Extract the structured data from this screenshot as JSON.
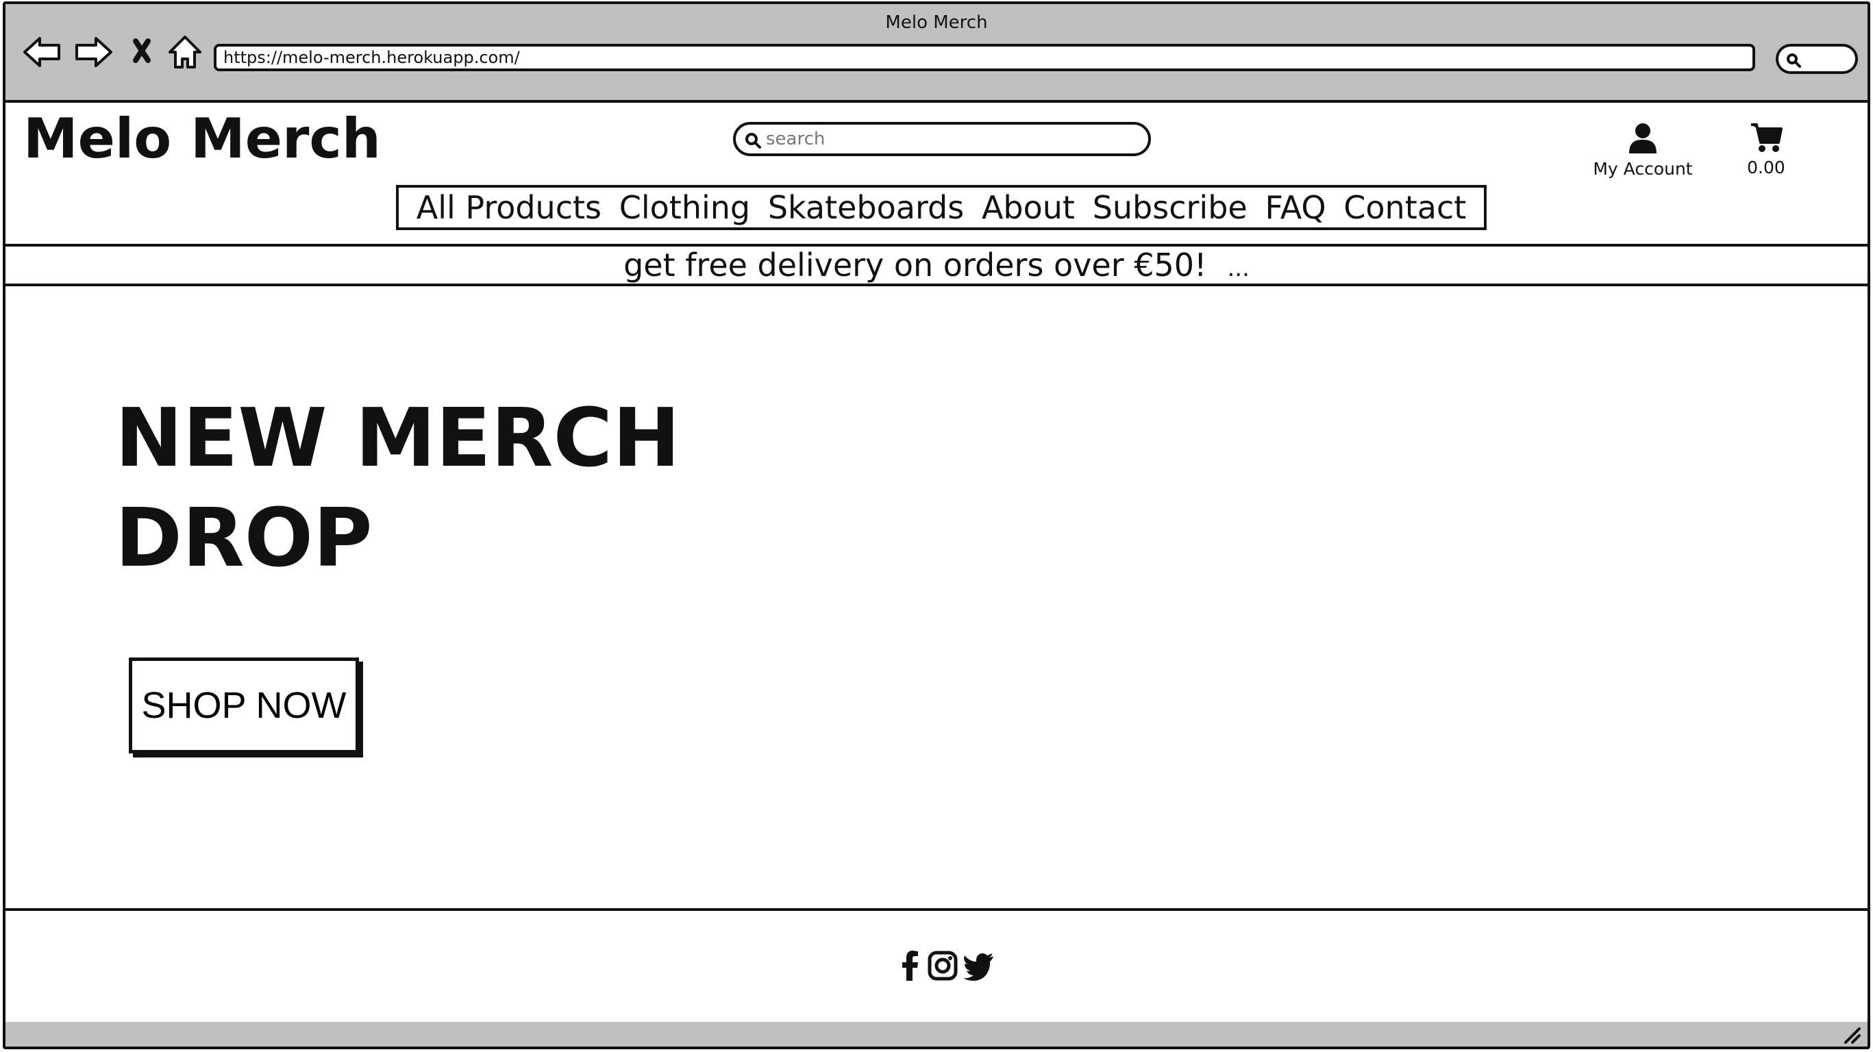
{
  "browser": {
    "window_title": "Melo Merch",
    "url": "https://melo-merch.herokuapp.com/"
  },
  "header": {
    "logo": "Melo Merch",
    "search_placeholder": "search",
    "account_label": "My Account",
    "cart_total": "0.00"
  },
  "nav": {
    "items": [
      "All Products",
      "Clothing",
      "Skateboards",
      "About",
      "Subscribe",
      "FAQ",
      "Contact"
    ]
  },
  "promo": {
    "text": "get free delivery on orders over €50!",
    "more": "..."
  },
  "hero": {
    "line1": "NEW MERCH",
    "line2": "DROP",
    "cta": "SHOP NOW"
  },
  "footer": {
    "icons": [
      "facebook-icon",
      "instagram-icon",
      "twitter-icon"
    ]
  }
}
